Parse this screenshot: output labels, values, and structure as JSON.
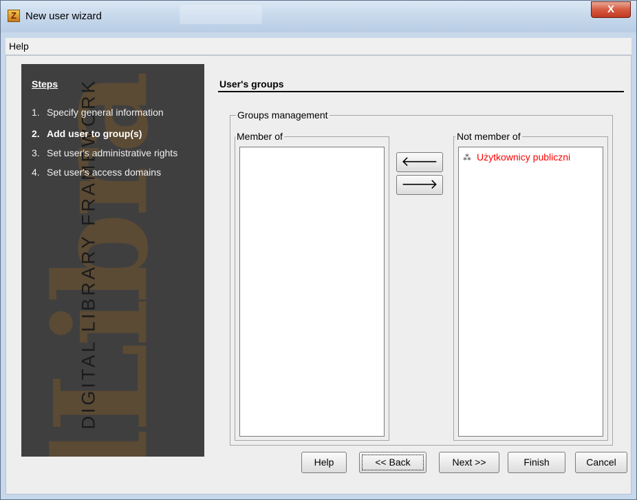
{
  "window": {
    "title": "New user wizard",
    "close_glyph": "X",
    "app_icon": "zlibra-logo"
  },
  "menu": {
    "items": [
      "Help"
    ]
  },
  "sidebar": {
    "title": "Steps",
    "steps": [
      {
        "num": "1.",
        "label": "Specify general information",
        "active": false
      },
      {
        "num": "2.",
        "label": "Add user to group(s)",
        "active": true
      },
      {
        "num": "3.",
        "label": "Set user's administrative rights",
        "active": false
      },
      {
        "num": "4.",
        "label": "Set user's access domains",
        "active": false
      }
    ],
    "watermark": {
      "logo": "dLibra",
      "tagline": "DIGITAL LIBRARY FRAMEWORK"
    }
  },
  "main": {
    "section_title": "User's groups",
    "groups_management": {
      "legend": "Groups management",
      "member_of": {
        "legend": "Member of",
        "items": []
      },
      "not_member_of": {
        "legend": "Not member of",
        "items": [
          {
            "label": "Użytkownicy publiczni",
            "color": "#ff0000",
            "icon": "group-icon"
          }
        ]
      },
      "move_left_glyph": "🡐",
      "move_right_glyph": "🡒"
    }
  },
  "buttons": {
    "help": "Help",
    "back": "<< Back",
    "next": "Next >>",
    "finish": "Finish",
    "cancel": "Cancel"
  }
}
